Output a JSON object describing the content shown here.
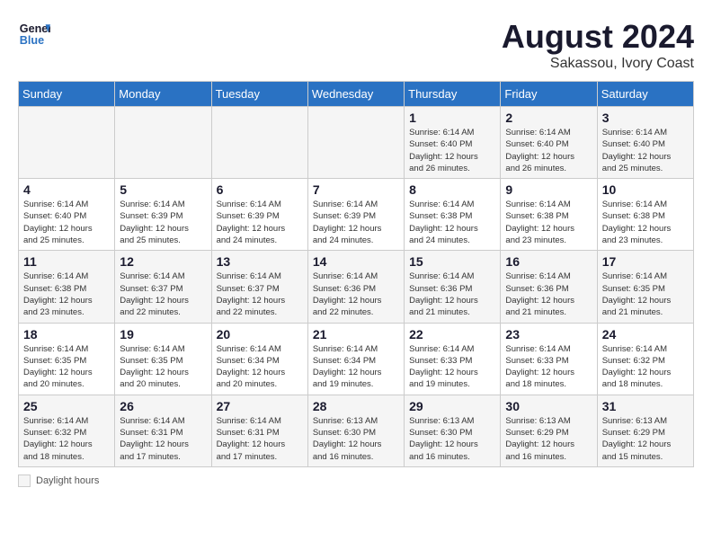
{
  "logo": {
    "line1": "General",
    "line2": "Blue"
  },
  "title": "August 2024",
  "subtitle": "Sakassou, Ivory Coast",
  "days_of_week": [
    "Sunday",
    "Monday",
    "Tuesday",
    "Wednesday",
    "Thursday",
    "Friday",
    "Saturday"
  ],
  "footer_label": "Daylight hours",
  "weeks": [
    [
      {
        "day": "",
        "info": ""
      },
      {
        "day": "",
        "info": ""
      },
      {
        "day": "",
        "info": ""
      },
      {
        "day": "",
        "info": ""
      },
      {
        "day": "1",
        "info": "Sunrise: 6:14 AM\nSunset: 6:40 PM\nDaylight: 12 hours\nand 26 minutes."
      },
      {
        "day": "2",
        "info": "Sunrise: 6:14 AM\nSunset: 6:40 PM\nDaylight: 12 hours\nand 26 minutes."
      },
      {
        "day": "3",
        "info": "Sunrise: 6:14 AM\nSunset: 6:40 PM\nDaylight: 12 hours\nand 25 minutes."
      }
    ],
    [
      {
        "day": "4",
        "info": "Sunrise: 6:14 AM\nSunset: 6:40 PM\nDaylight: 12 hours\nand 25 minutes."
      },
      {
        "day": "5",
        "info": "Sunrise: 6:14 AM\nSunset: 6:39 PM\nDaylight: 12 hours\nand 25 minutes."
      },
      {
        "day": "6",
        "info": "Sunrise: 6:14 AM\nSunset: 6:39 PM\nDaylight: 12 hours\nand 24 minutes."
      },
      {
        "day": "7",
        "info": "Sunrise: 6:14 AM\nSunset: 6:39 PM\nDaylight: 12 hours\nand 24 minutes."
      },
      {
        "day": "8",
        "info": "Sunrise: 6:14 AM\nSunset: 6:38 PM\nDaylight: 12 hours\nand 24 minutes."
      },
      {
        "day": "9",
        "info": "Sunrise: 6:14 AM\nSunset: 6:38 PM\nDaylight: 12 hours\nand 23 minutes."
      },
      {
        "day": "10",
        "info": "Sunrise: 6:14 AM\nSunset: 6:38 PM\nDaylight: 12 hours\nand 23 minutes."
      }
    ],
    [
      {
        "day": "11",
        "info": "Sunrise: 6:14 AM\nSunset: 6:38 PM\nDaylight: 12 hours\nand 23 minutes."
      },
      {
        "day": "12",
        "info": "Sunrise: 6:14 AM\nSunset: 6:37 PM\nDaylight: 12 hours\nand 22 minutes."
      },
      {
        "day": "13",
        "info": "Sunrise: 6:14 AM\nSunset: 6:37 PM\nDaylight: 12 hours\nand 22 minutes."
      },
      {
        "day": "14",
        "info": "Sunrise: 6:14 AM\nSunset: 6:36 PM\nDaylight: 12 hours\nand 22 minutes."
      },
      {
        "day": "15",
        "info": "Sunrise: 6:14 AM\nSunset: 6:36 PM\nDaylight: 12 hours\nand 21 minutes."
      },
      {
        "day": "16",
        "info": "Sunrise: 6:14 AM\nSunset: 6:36 PM\nDaylight: 12 hours\nand 21 minutes."
      },
      {
        "day": "17",
        "info": "Sunrise: 6:14 AM\nSunset: 6:35 PM\nDaylight: 12 hours\nand 21 minutes."
      }
    ],
    [
      {
        "day": "18",
        "info": "Sunrise: 6:14 AM\nSunset: 6:35 PM\nDaylight: 12 hours\nand 20 minutes."
      },
      {
        "day": "19",
        "info": "Sunrise: 6:14 AM\nSunset: 6:35 PM\nDaylight: 12 hours\nand 20 minutes."
      },
      {
        "day": "20",
        "info": "Sunrise: 6:14 AM\nSunset: 6:34 PM\nDaylight: 12 hours\nand 20 minutes."
      },
      {
        "day": "21",
        "info": "Sunrise: 6:14 AM\nSunset: 6:34 PM\nDaylight: 12 hours\nand 19 minutes."
      },
      {
        "day": "22",
        "info": "Sunrise: 6:14 AM\nSunset: 6:33 PM\nDaylight: 12 hours\nand 19 minutes."
      },
      {
        "day": "23",
        "info": "Sunrise: 6:14 AM\nSunset: 6:33 PM\nDaylight: 12 hours\nand 18 minutes."
      },
      {
        "day": "24",
        "info": "Sunrise: 6:14 AM\nSunset: 6:32 PM\nDaylight: 12 hours\nand 18 minutes."
      }
    ],
    [
      {
        "day": "25",
        "info": "Sunrise: 6:14 AM\nSunset: 6:32 PM\nDaylight: 12 hours\nand 18 minutes."
      },
      {
        "day": "26",
        "info": "Sunrise: 6:14 AM\nSunset: 6:31 PM\nDaylight: 12 hours\nand 17 minutes."
      },
      {
        "day": "27",
        "info": "Sunrise: 6:14 AM\nSunset: 6:31 PM\nDaylight: 12 hours\nand 17 minutes."
      },
      {
        "day": "28",
        "info": "Sunrise: 6:13 AM\nSunset: 6:30 PM\nDaylight: 12 hours\nand 16 minutes."
      },
      {
        "day": "29",
        "info": "Sunrise: 6:13 AM\nSunset: 6:30 PM\nDaylight: 12 hours\nand 16 minutes."
      },
      {
        "day": "30",
        "info": "Sunrise: 6:13 AM\nSunset: 6:29 PM\nDaylight: 12 hours\nand 16 minutes."
      },
      {
        "day": "31",
        "info": "Sunrise: 6:13 AM\nSunset: 6:29 PM\nDaylight: 12 hours\nand 15 minutes."
      }
    ]
  ]
}
